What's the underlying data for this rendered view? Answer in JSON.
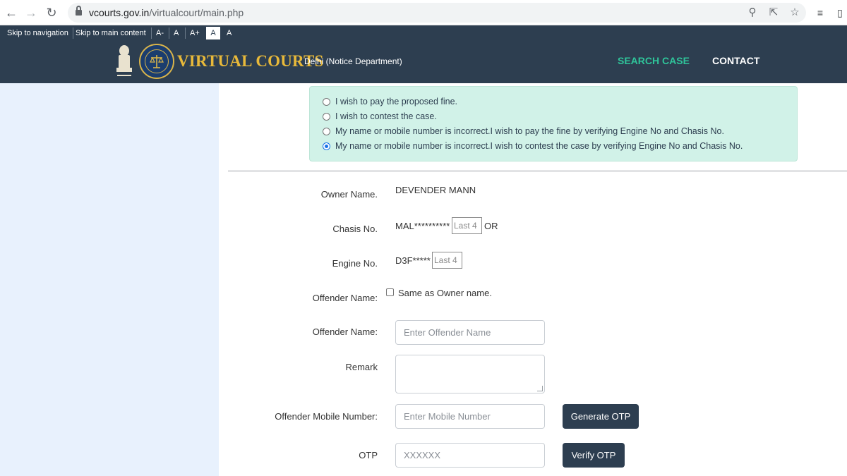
{
  "browser": {
    "url_domain": "vcourts.gov.in",
    "url_path": "/virtualcourt/main.php"
  },
  "accessibility": {
    "skip_navigation": "Skip to navigation",
    "skip_main": "Skip to main content",
    "font_decrease": "A-",
    "font_normal": "A",
    "font_increase": "A+",
    "theme_light": "A",
    "theme_dark": "A"
  },
  "header": {
    "brand": "VIRTUAL COURTS",
    "department": "Delhi (Notice Department)",
    "menu": [
      "SEARCH CASE",
      "CONTACT"
    ]
  },
  "options": [
    {
      "label": "I wish to pay the proposed fine.",
      "checked": false
    },
    {
      "label": "I wish to contest the case.",
      "checked": false
    },
    {
      "label": "My name or mobile number is incorrect.I wish to pay the fine by verifying Engine No and Chasis No.",
      "checked": false
    },
    {
      "label": "My name or mobile number is incorrect.I wish to contest the case by verifying Engine No and Chasis No.",
      "checked": true
    }
  ],
  "form": {
    "owner_name_label": "Owner Name.",
    "owner_name_value": "DEVENDER MANN",
    "chasis_label": "Chasis No.",
    "chasis_prefix": "MAL**********",
    "chasis_placeholder": "Last 4",
    "chasis_or": "OR",
    "engine_label": "Engine No.",
    "engine_prefix": "D3F*****",
    "engine_placeholder": "Last 4",
    "offender_name_label_1": "Offender Name:",
    "same_as_owner": "Same as Owner name.",
    "offender_name_label_2": "Offender Name:",
    "offender_name_placeholder": "Enter Offender Name",
    "remark_label": "Remark",
    "mobile_label": "Offender Mobile Number:",
    "mobile_placeholder": "Enter Mobile Number",
    "generate_otp": "Generate OTP",
    "otp_label": "OTP",
    "otp_placeholder": "XXXXXX",
    "verify_otp": "Verify OTP"
  },
  "colors": {
    "navy": "#2d3e50",
    "accent_green": "#2fc49a",
    "brand_gold": "#e8b93a",
    "option_bg": "#d1f2e8",
    "left_panel": "#e8f1fd"
  }
}
